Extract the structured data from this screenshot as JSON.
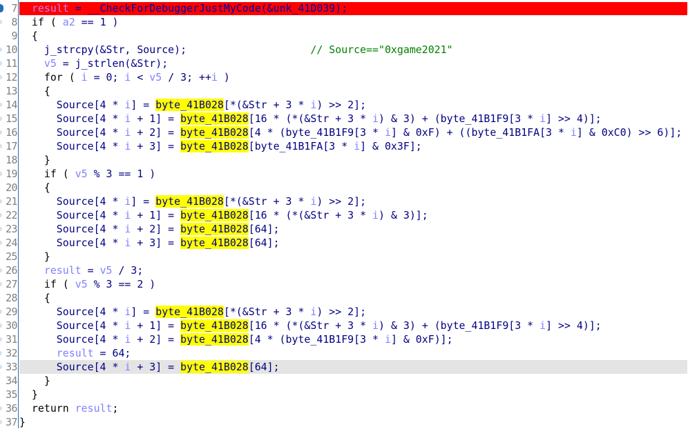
{
  "editor": {
    "view": "pseudocode",
    "breakpoint_line": 7,
    "current_line": 33,
    "lines": [
      {
        "num": "7",
        "tokens": [
          [
            "  ",
            "k"
          ],
          [
            "result",
            "v"
          ],
          [
            " = ",
            "n"
          ],
          [
            "__CheckForDebuggerJustMyCode",
            "n"
          ],
          [
            "(&unk_41D039);",
            "n"
          ]
        ]
      },
      {
        "num": "8",
        "tokens": [
          [
            "  if ( ",
            "k"
          ],
          [
            "a2",
            "v"
          ],
          [
            " == 1 )",
            "n"
          ]
        ]
      },
      {
        "num": "9",
        "tokens": [
          [
            "  {",
            "k"
          ]
        ]
      },
      {
        "num": "10",
        "tokens": [
          [
            "    j_strcpy(&Str, Source);",
            "n"
          ],
          [
            "                    ",
            "k"
          ],
          [
            "// Source==\"0xgame2021\"",
            "c"
          ]
        ]
      },
      {
        "num": "11",
        "tokens": [
          [
            "    ",
            "k"
          ],
          [
            "v5",
            "v"
          ],
          [
            " = j_strlen(&Str);",
            "n"
          ]
        ]
      },
      {
        "num": "12",
        "tokens": [
          [
            "    for ( ",
            "k"
          ],
          [
            "i",
            "v"
          ],
          [
            " = 0; ",
            "n"
          ],
          [
            "i",
            "v"
          ],
          [
            " < ",
            "n"
          ],
          [
            "v5",
            "v"
          ],
          [
            " / 3; ++",
            "n"
          ],
          [
            "i",
            "v"
          ],
          [
            " )",
            "n"
          ]
        ]
      },
      {
        "num": "13",
        "tokens": [
          [
            "    {",
            "k"
          ]
        ]
      },
      {
        "num": "14",
        "tokens": [
          [
            "      Source[4 * ",
            "n"
          ],
          [
            "i",
            "v"
          ],
          [
            "] = ",
            "n"
          ],
          [
            "byte_41B028",
            "h"
          ],
          [
            "[*(&Str + 3 * ",
            "n"
          ],
          [
            "i",
            "v"
          ],
          [
            ") >> 2];",
            "n"
          ]
        ]
      },
      {
        "num": "15",
        "tokens": [
          [
            "      Source[4 * ",
            "n"
          ],
          [
            "i",
            "v"
          ],
          [
            " + 1] = ",
            "n"
          ],
          [
            "byte_41B028",
            "h"
          ],
          [
            "[16 * (*(&Str + 3 * ",
            "n"
          ],
          [
            "i",
            "v"
          ],
          [
            ") & 3) + (byte_41B1F9[3 * ",
            "n"
          ],
          [
            "i",
            "v"
          ],
          [
            "] >> 4)];",
            "n"
          ]
        ]
      },
      {
        "num": "16",
        "tokens": [
          [
            "      Source[4 * ",
            "n"
          ],
          [
            "i",
            "v"
          ],
          [
            " + 2] = ",
            "n"
          ],
          [
            "byte_41B028",
            "h"
          ],
          [
            "[4 * (byte_41B1F9[3 * ",
            "n"
          ],
          [
            "i",
            "v"
          ],
          [
            "] & 0xF) + ((byte_41B1FA[3 * ",
            "n"
          ],
          [
            "i",
            "v"
          ],
          [
            "] & 0xC0) >> 6)];",
            "n"
          ]
        ]
      },
      {
        "num": "17",
        "tokens": [
          [
            "      Source[4 * ",
            "n"
          ],
          [
            "i",
            "v"
          ],
          [
            " + 3] = ",
            "n"
          ],
          [
            "byte_41B028",
            "h"
          ],
          [
            "[byte_41B1FA[3 * ",
            "n"
          ],
          [
            "i",
            "v"
          ],
          [
            "] & 0x3F];",
            "n"
          ]
        ]
      },
      {
        "num": "18",
        "tokens": [
          [
            "    }",
            "k"
          ]
        ]
      },
      {
        "num": "19",
        "tokens": [
          [
            "    if ( ",
            "k"
          ],
          [
            "v5",
            "v"
          ],
          [
            " % 3 == 1 )",
            "n"
          ]
        ]
      },
      {
        "num": "20",
        "tokens": [
          [
            "    {",
            "k"
          ]
        ]
      },
      {
        "num": "21",
        "tokens": [
          [
            "      Source[4 * ",
            "n"
          ],
          [
            "i",
            "v"
          ],
          [
            "] = ",
            "n"
          ],
          [
            "byte_41B028",
            "h"
          ],
          [
            "[*(&Str + 3 * ",
            "n"
          ],
          [
            "i",
            "v"
          ],
          [
            ") >> 2];",
            "n"
          ]
        ]
      },
      {
        "num": "22",
        "tokens": [
          [
            "      Source[4 * ",
            "n"
          ],
          [
            "i",
            "v"
          ],
          [
            " + 1] = ",
            "n"
          ],
          [
            "byte_41B028",
            "h"
          ],
          [
            "[16 * (*(&Str + 3 * ",
            "n"
          ],
          [
            "i",
            "v"
          ],
          [
            ") & 3)];",
            "n"
          ]
        ]
      },
      {
        "num": "23",
        "tokens": [
          [
            "      Source[4 * ",
            "n"
          ],
          [
            "i",
            "v"
          ],
          [
            " + 2] = ",
            "n"
          ],
          [
            "byte_41B028",
            "h"
          ],
          [
            "[64];",
            "n"
          ]
        ]
      },
      {
        "num": "24",
        "tokens": [
          [
            "      Source[4 * ",
            "n"
          ],
          [
            "i",
            "v"
          ],
          [
            " + 3] = ",
            "n"
          ],
          [
            "byte_41B028",
            "h"
          ],
          [
            "[64];",
            "n"
          ]
        ]
      },
      {
        "num": "25",
        "tokens": [
          [
            "    }",
            "k"
          ]
        ]
      },
      {
        "num": "26",
        "tokens": [
          [
            "    ",
            "k"
          ],
          [
            "result",
            "v"
          ],
          [
            " = ",
            "n"
          ],
          [
            "v5",
            "v"
          ],
          [
            " / 3;",
            "n"
          ]
        ]
      },
      {
        "num": "27",
        "tokens": [
          [
            "    if ( ",
            "k"
          ],
          [
            "v5",
            "v"
          ],
          [
            " % 3 == 2 )",
            "n"
          ]
        ]
      },
      {
        "num": "28",
        "tokens": [
          [
            "    {",
            "k"
          ]
        ]
      },
      {
        "num": "29",
        "tokens": [
          [
            "      Source[4 * ",
            "n"
          ],
          [
            "i",
            "v"
          ],
          [
            "] = ",
            "n"
          ],
          [
            "byte_41B028",
            "h"
          ],
          [
            "[*(&Str + 3 * ",
            "n"
          ],
          [
            "i",
            "v"
          ],
          [
            ") >> 2];",
            "n"
          ]
        ]
      },
      {
        "num": "30",
        "tokens": [
          [
            "      Source[4 * ",
            "n"
          ],
          [
            "i",
            "v"
          ],
          [
            " + 1] = ",
            "n"
          ],
          [
            "byte_41B028",
            "h"
          ],
          [
            "[16 * (*(&Str + 3 * ",
            "n"
          ],
          [
            "i",
            "v"
          ],
          [
            ") & 3) + (byte_41B1F9[3 * ",
            "n"
          ],
          [
            "i",
            "v"
          ],
          [
            "] >> 4)];",
            "n"
          ]
        ]
      },
      {
        "num": "31",
        "tokens": [
          [
            "      Source[4 * ",
            "n"
          ],
          [
            "i",
            "v"
          ],
          [
            " + 2] = ",
            "n"
          ],
          [
            "byte_41B028",
            "h"
          ],
          [
            "[4 * (byte_41B1F9[3 * ",
            "n"
          ],
          [
            "i",
            "v"
          ],
          [
            "] & 0xF)];",
            "n"
          ]
        ]
      },
      {
        "num": "32",
        "tokens": [
          [
            "      ",
            "k"
          ],
          [
            "result",
            "v"
          ],
          [
            " = 64;",
            "n"
          ]
        ]
      },
      {
        "num": "33",
        "tokens": [
          [
            "      Source[4 * ",
            "n"
          ],
          [
            "i",
            "v"
          ],
          [
            " + 3] = ",
            "n"
          ],
          [
            "byte_",
            "h"
          ],
          [
            "|",
            "caret"
          ],
          [
            "41B028",
            "h"
          ],
          [
            "[64];",
            "n"
          ]
        ]
      },
      {
        "num": "34",
        "tokens": [
          [
            "    }",
            "k"
          ]
        ]
      },
      {
        "num": "35",
        "tokens": [
          [
            "  }",
            "k"
          ]
        ]
      },
      {
        "num": "36",
        "tokens": [
          [
            "  return ",
            "k"
          ],
          [
            "result",
            "v"
          ],
          [
            ";",
            "k"
          ]
        ]
      },
      {
        "num": "37",
        "tokens": [
          [
            "}",
            "k"
          ]
        ]
      }
    ],
    "marker_lines": [
      "7",
      "8",
      "10",
      "11",
      "12",
      "14",
      "15",
      "16",
      "17",
      "19",
      "21",
      "22",
      "23",
      "24",
      "26",
      "27",
      "29",
      "30",
      "31",
      "32",
      "33",
      "36",
      "37"
    ]
  },
  "colors": {
    "breakpoint_bg": "#ff0000",
    "current_line_bg": "#e4e4e4",
    "highlight": "#ffff00",
    "identifier": "#000080",
    "variable": "#8080ff",
    "comment": "#008000"
  }
}
